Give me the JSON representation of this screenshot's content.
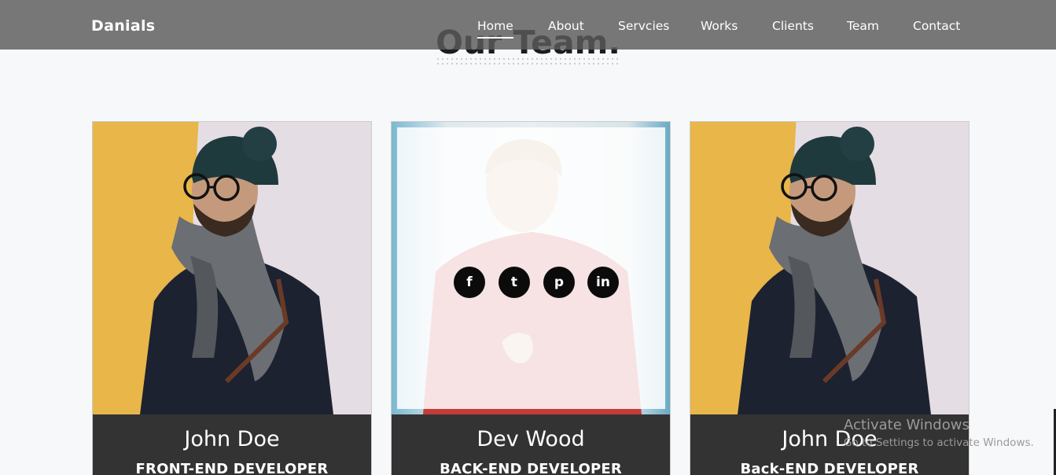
{
  "brand": "Danials",
  "nav": {
    "items": [
      "Home",
      "About",
      "Servcies",
      "Works",
      "Clients",
      "Team",
      "Contact"
    ],
    "active_index": 0
  },
  "section": {
    "title": "Our Team."
  },
  "team": [
    {
      "name": "John Doe",
      "role": "FRONT-END DEVELOPER"
    },
    {
      "name": "Dev Wood",
      "role": "BACK-END DEVELOPER"
    },
    {
      "name": "John Doe",
      "role": "Back-END DEVELOPER"
    }
  ],
  "social_icons": [
    "facebook-icon",
    "twitter-icon",
    "pinterest-icon",
    "linkedin-icon"
  ],
  "social_glyphs": [
    "f",
    "t",
    "p",
    "in"
  ],
  "watermark": {
    "title": "Activate Windows",
    "subtitle": "Go to Settings to activate Windows."
  },
  "colors": {
    "navbar": "#5a5a5a",
    "card_footer": "#333333",
    "social_button": "#0b0b0b",
    "photo_yellow": "#e8b649",
    "photo_blue": "#71b2cc"
  }
}
